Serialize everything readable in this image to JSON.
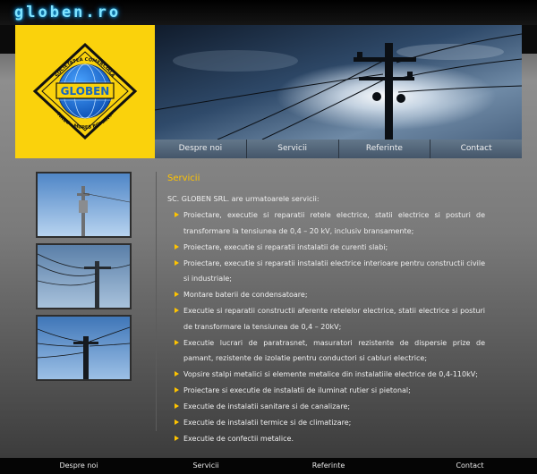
{
  "site": {
    "title": "globen.ro"
  },
  "logo": {
    "top_text": "SOCIETATEA COMERCIALA",
    "brand": "GLOBEN",
    "bottom_text": "TIRGU - MURES ROMANIA"
  },
  "nav": {
    "items": [
      "Despre noi",
      "Servicii",
      "Referinte",
      "Contact"
    ]
  },
  "main": {
    "section_title": "Servicii",
    "intro": "SC. GLOBEN SRL. are urmatoarele servicii:",
    "services": [
      "Proiectare, executie si reparatii retele electrice, statii electrice si posturi de transformare la tensiunea de 0,4 – 20 kV, inclusiv bransamente;",
      "Proiectare, executie si reparatii instalatii de curenti slabi;",
      "Proiectare, executie si reparatii instalatii electrice interioare pentru constructii civile si industriale;",
      "Montare baterii de condensatoare;",
      "Executie si reparatii constructii aferente retelelor electrice, statii electrice si posturi de transformare la tensiunea de 0,4 – 20kV;",
      "Executie lucrari de paratrasnet, masuratori rezistente de dispersie prize de pamant, rezistente de izolatie pentru conductori si cabluri electrice;",
      "Vopsire stalpi metalici si elemente metalice din instalatiile electrice de 0,4-110kV;",
      "Proiectare si executie de instalatii de iluminat rutier si pietonal;",
      "Executie de instalatii sanitare si de canalizare;",
      "Executie de instalatii termice si de climatizare;",
      "Executie de confectii metalice."
    ]
  },
  "footer": {
    "items": [
      "Despre noi",
      "Servicii",
      "Referinte",
      "Contact"
    ]
  },
  "colors": {
    "accent": "#ffc400",
    "logo_bg": "#fad20c",
    "title_glow": "#7fe3ff"
  }
}
